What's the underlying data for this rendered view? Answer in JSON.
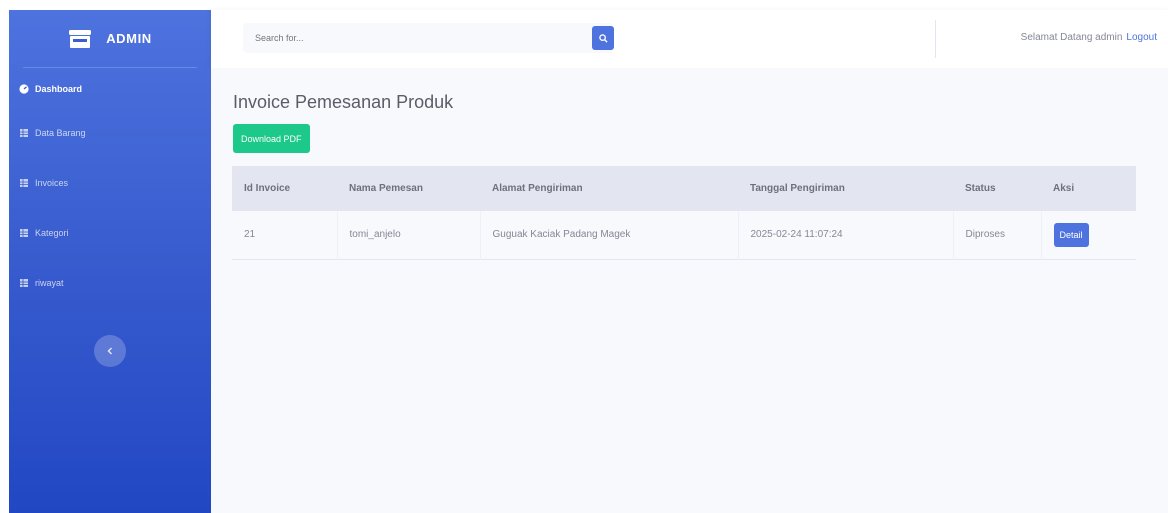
{
  "brand": {
    "name": "ADMIN",
    "icon": "store-icon"
  },
  "sidebar": {
    "items": [
      {
        "label": "Dashboard",
        "icon": "tachometer-icon",
        "active": true
      },
      {
        "label": "Data Barang",
        "icon": "table-icon",
        "active": false
      },
      {
        "label": "Invoices",
        "icon": "table-icon",
        "active": false
      },
      {
        "label": "Kategori",
        "icon": "table-icon",
        "active": false
      },
      {
        "label": "riwayat",
        "icon": "table-icon",
        "active": false
      }
    ],
    "toggle_icon": "chevron-left-icon"
  },
  "topbar": {
    "search_placeholder": "Search for...",
    "search_icon": "search-icon",
    "greeting": "Selamat Datang admin",
    "logout_label": "Logout"
  },
  "main": {
    "title": "Invoice Pemesanan Produk",
    "download_label": "Download PDF",
    "table": {
      "headers": [
        "Id Invoice",
        "Nama Pemesan",
        "Alamat Pengiriman",
        "Tanggal Pengiriman",
        "Status",
        "Aksi"
      ],
      "rows": [
        {
          "id": "21",
          "nama": "tomi_anjelo",
          "alamat": "Guguak Kaciak Padang Magek",
          "tanggal": "2025-02-24 11:07:24",
          "status": "Diproses",
          "action_label": "Detail"
        }
      ]
    }
  },
  "colors": {
    "primary": "#4e73df",
    "success": "#1cc88a",
    "sidebar_bottom": "#2247c4"
  }
}
